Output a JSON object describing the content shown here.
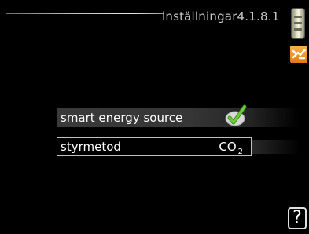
{
  "header": {
    "title": "inställningar4.1.8.1"
  },
  "settings": [
    {
      "label": "smart energy source",
      "value_type": "checkbox",
      "checked": true
    },
    {
      "label": "styrmetod",
      "value_main": "CO",
      "value_sub": "2"
    }
  ],
  "help": {
    "label": "?"
  },
  "icons": {
    "scroll": "scroll-indicator-icon",
    "menu": "menu-settings-icon",
    "check": "checkmark-icon"
  },
  "colors": {
    "background": "#000000",
    "accent_orange": "#e8901e",
    "check_green": "#5bb531"
  }
}
